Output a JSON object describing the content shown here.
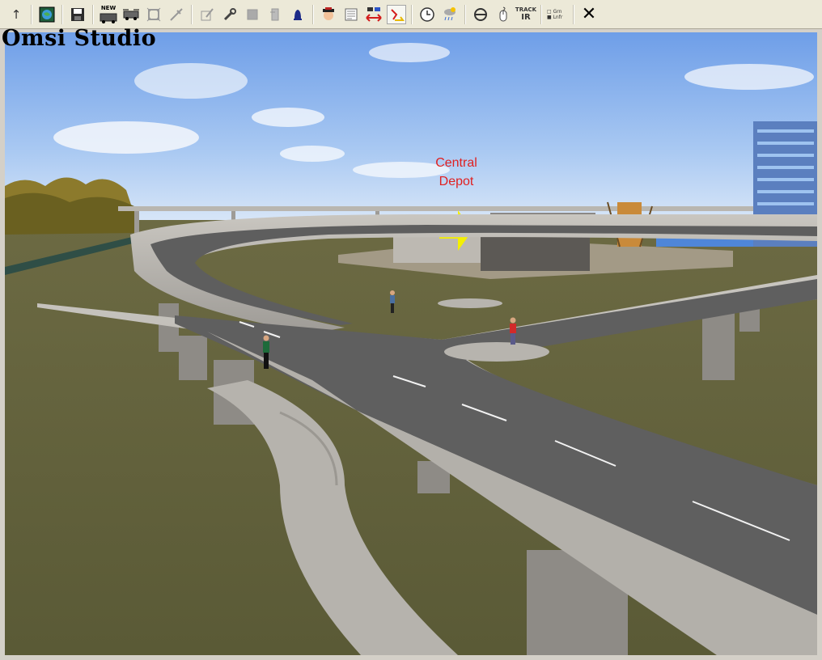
{
  "app": {
    "title": "Omsi Studio"
  },
  "scene": {
    "depot_label": "Central\nDepot"
  },
  "toolbar": {
    "new_label": "NEW",
    "track_label": "TRACK",
    "ir_label": "IR",
    "check_a_label": "Grn",
    "check_b_label": "Lnfr"
  }
}
